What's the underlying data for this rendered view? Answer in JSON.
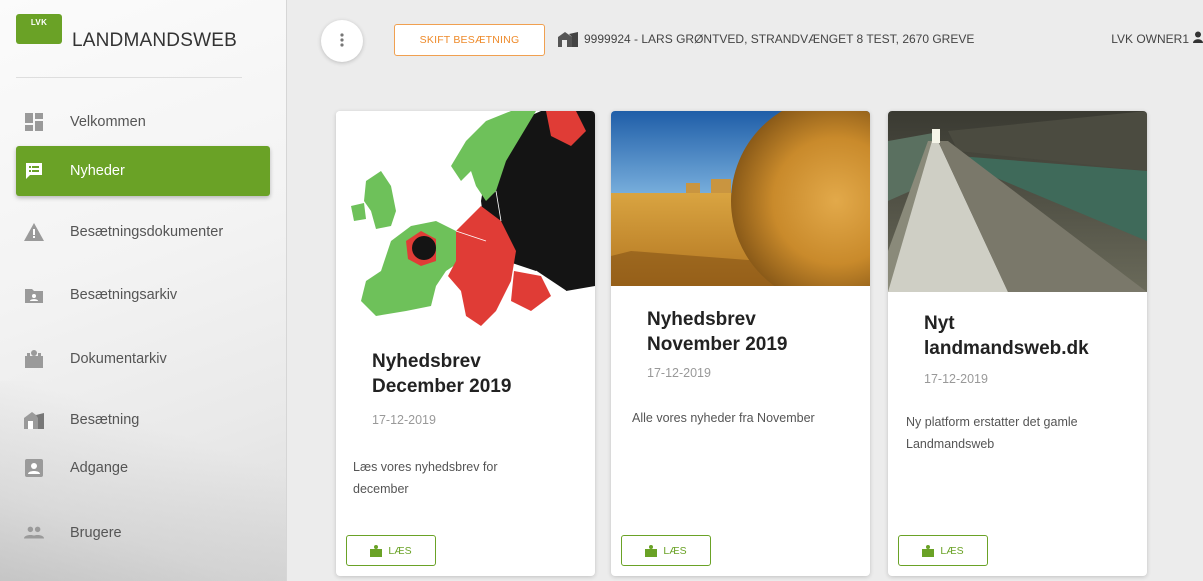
{
  "brand": {
    "logo_text": "LVK",
    "title": "LANDMANDSWEB",
    "accent": "#6aa226"
  },
  "nav": [
    {
      "label": "Velkommen",
      "icon": "dashboard-icon",
      "active": false
    },
    {
      "label": "Nyheder",
      "icon": "news-icon",
      "active": true
    },
    {
      "label": "Besætningsdokumenter",
      "icon": "warning-icon",
      "active": false
    },
    {
      "label": "Besætningsarkiv",
      "icon": "folder-icon",
      "active": false
    },
    {
      "label": "Dokumentarkiv",
      "icon": "archive-icon",
      "active": false
    },
    {
      "label": "Besætning",
      "icon": "barn-icon",
      "active": false
    },
    {
      "label": "Adgange",
      "icon": "id-card-icon",
      "active": false
    },
    {
      "label": "Brugere",
      "icon": "users-icon",
      "active": false
    }
  ],
  "topbar": {
    "menu_icon": "more-vertical-icon",
    "change_herd_label": "SKIFT BESÆTNING",
    "farm_label": "9999924 - LARS GRØNTVED, STRANDVÆNGET 8 TEST, 2670 GREVE",
    "user_label": "LVK OWNER1",
    "orange": "#ee8a2a"
  },
  "cards": [
    {
      "title": "Nyhedsbrev December 2019",
      "date": "17-12-2019",
      "description": "Læs vores nyhedsbrev for december",
      "button_label": "LÆS",
      "image": "europe-map-image"
    },
    {
      "title": "Nyhedsbrev November 2019",
      "date": "17-12-2019",
      "description": "Alle vores nyheder fra November",
      "button_label": "LÆS",
      "image": "hay-bale-field-image"
    },
    {
      "title": "Nyt landmandsweb.dk",
      "date": "17-12-2019",
      "description": "Ny platform erstatter det gamle Landmandsweb",
      "button_label": "LÆS",
      "image": "barn-interior-image"
    }
  ]
}
